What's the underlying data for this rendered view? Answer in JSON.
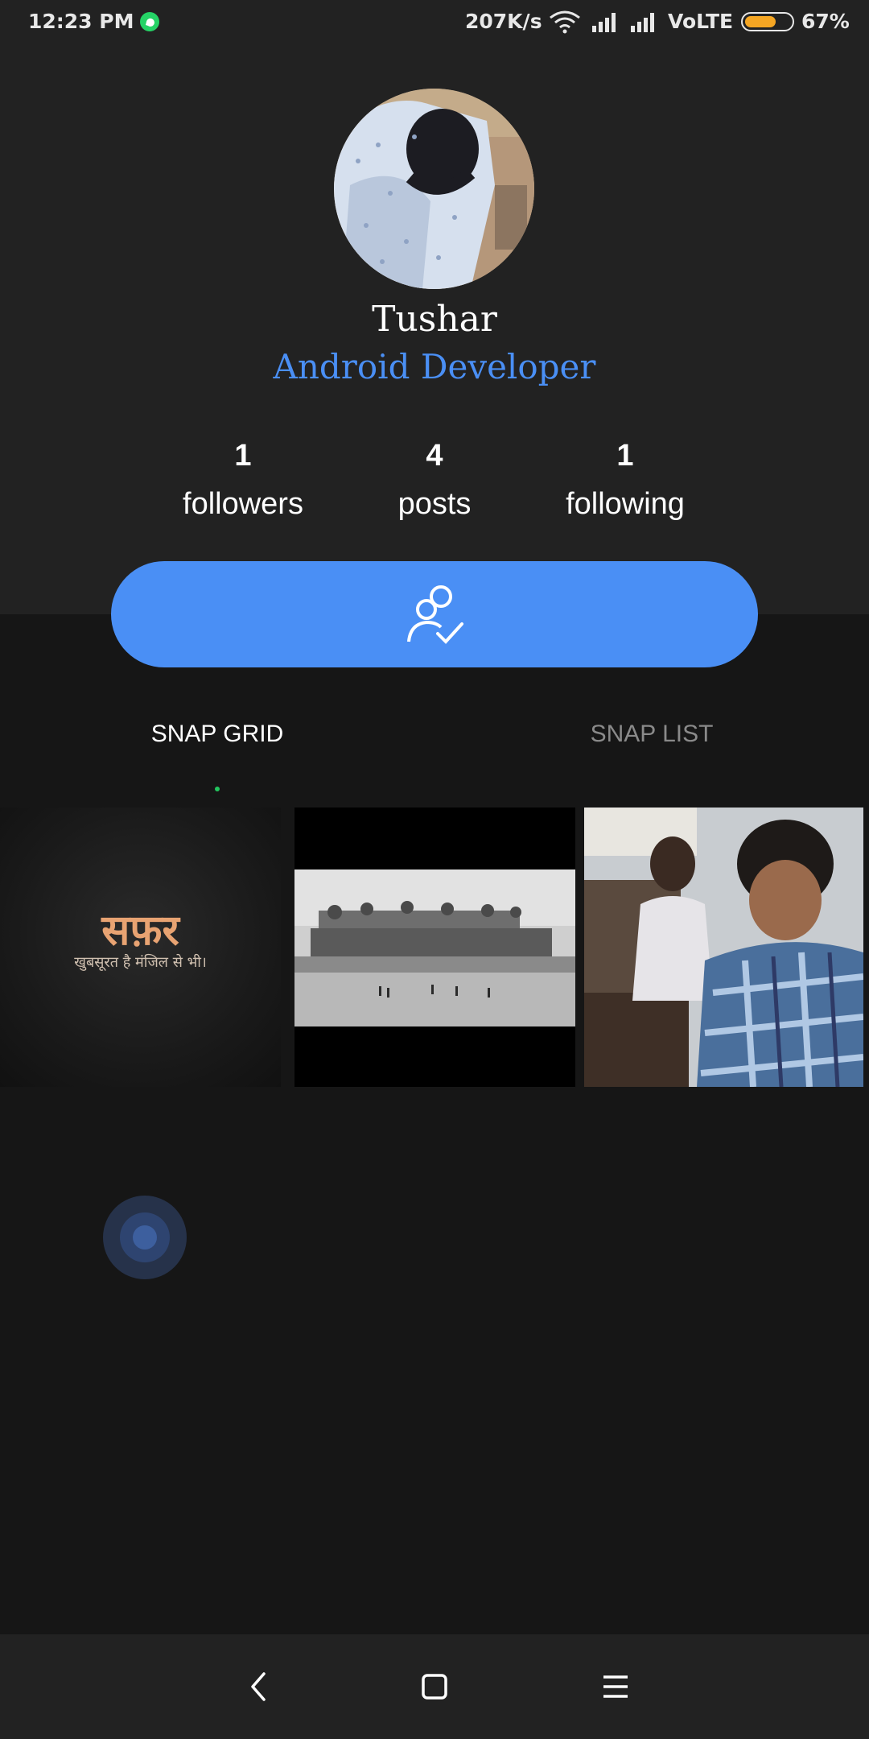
{
  "status_bar": {
    "time": "12:23 PM",
    "net_speed": "207K/s",
    "network_type": "VoLTE",
    "battery_percent": "67%",
    "battery_level": 0.67,
    "icons": [
      "whatsapp-icon",
      "wifi-icon",
      "signal-icon",
      "signal-icon",
      "battery-icon"
    ]
  },
  "profile": {
    "name": "Tushar",
    "role": "Android Developer",
    "stats": [
      {
        "value": "1",
        "label": "followers"
      },
      {
        "value": "4",
        "label": "posts"
      },
      {
        "value": "1",
        "label": "following"
      }
    ],
    "follow_button_icon": "user-check-icon"
  },
  "tabs": {
    "grid_label": "SNAP GRID",
    "list_label": "SNAP LIST",
    "active": "grid"
  },
  "posts": [
    {
      "title": "सफ़र",
      "subtitle": "खुबसूरत है मंजिल से भी।"
    },
    {
      "description": "fort"
    },
    {
      "description": "people"
    }
  ],
  "nav_bar": {
    "icons": [
      "back-icon",
      "home-icon",
      "menu-icon"
    ]
  },
  "colors": {
    "accent": "#4a8ff5",
    "background": "#161616",
    "header_bg": "#222222"
  }
}
